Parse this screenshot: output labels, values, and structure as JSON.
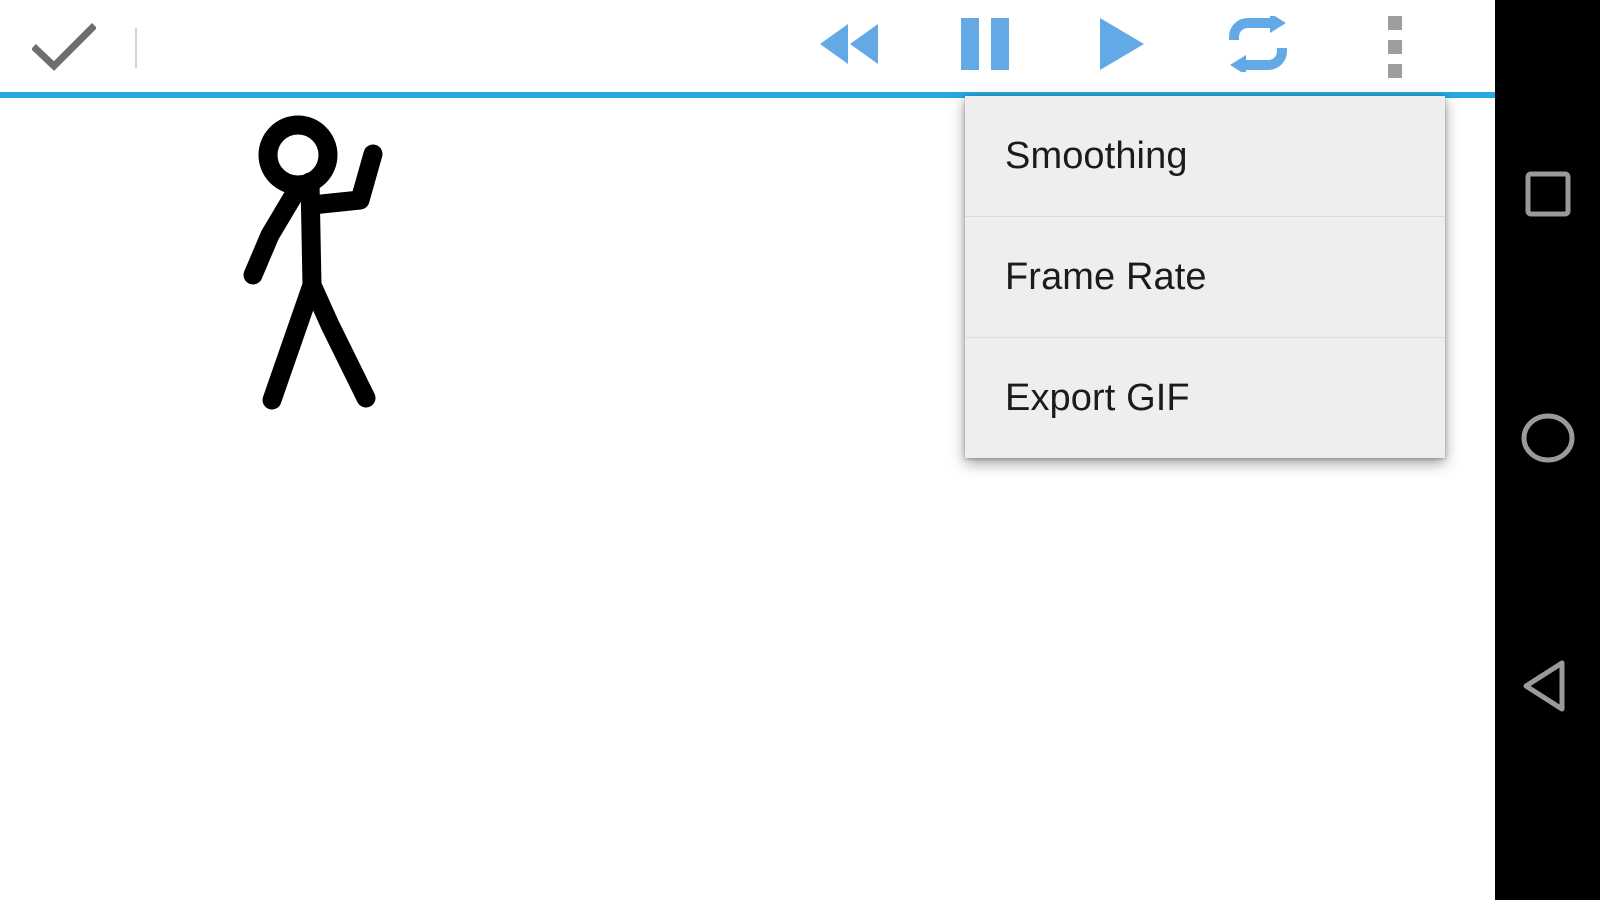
{
  "app": {
    "name": "stick-figure-animator",
    "canvas_background": "#ffffff",
    "accent_color": "#26a8e0",
    "icon_blue": "#63a9e6",
    "icon_gray": "#9e9e9e"
  },
  "toolbar": {
    "accept_label": "check-icon",
    "buttons": [
      {
        "name": "accept",
        "icon": "check-icon",
        "label": "Accept"
      },
      {
        "name": "rewind",
        "icon": "rewind-icon",
        "label": "Rewind"
      },
      {
        "name": "pause",
        "icon": "pause-icon",
        "label": "Pause"
      },
      {
        "name": "play",
        "icon": "play-icon",
        "label": "Play"
      },
      {
        "name": "loop",
        "icon": "loop-icon",
        "label": "Loop"
      },
      {
        "name": "overflow",
        "icon": "more-vertical-icon",
        "label": "More options"
      }
    ]
  },
  "overflow_menu": {
    "visible": true,
    "background": "#eeeeee",
    "items": [
      {
        "label": "Smoothing"
      },
      {
        "label": "Frame Rate"
      },
      {
        "label": "Export GIF"
      }
    ]
  },
  "canvas": {
    "drawing": "stick-figure-waving",
    "stroke_color": "#000000"
  },
  "nav_bar": {
    "background": "#000000",
    "buttons": [
      {
        "name": "recents",
        "icon": "square-icon",
        "label": "Recents"
      },
      {
        "name": "home",
        "icon": "circle-icon",
        "label": "Home"
      },
      {
        "name": "back",
        "icon": "triangle-left-icon",
        "label": "Back"
      }
    ]
  }
}
